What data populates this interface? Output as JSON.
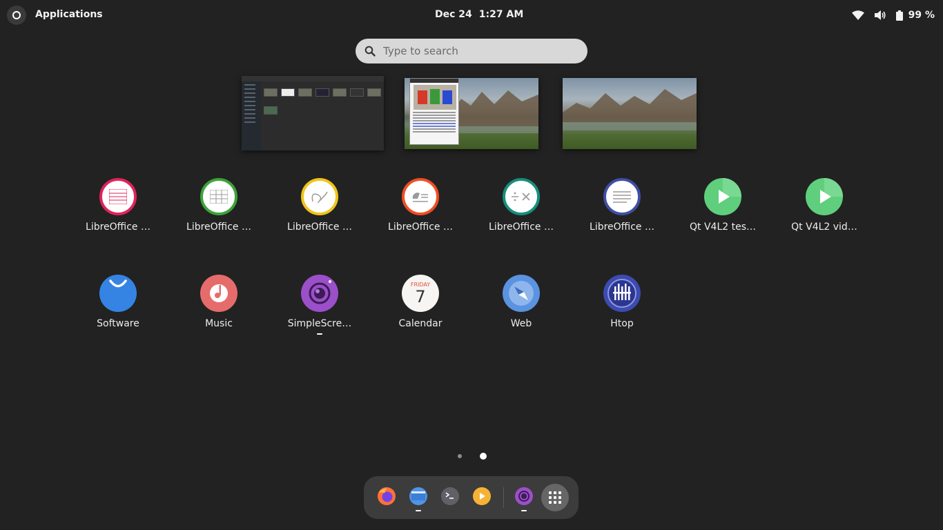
{
  "topbar": {
    "app_name": "Applications",
    "date": "Dec 24",
    "time": "1:27 AM",
    "battery": "99 %",
    "icons": [
      "activities-icon",
      "wifi-icon",
      "volume-icon",
      "battery-icon"
    ]
  },
  "search": {
    "placeholder": "Type to search"
  },
  "workspaces": [
    {
      "name": "workspace-1",
      "content": "file-manager"
    },
    {
      "name": "workspace-2",
      "content": "simplescreenrecorder-window"
    },
    {
      "name": "workspace-3",
      "content": "desktop-wallpaper"
    }
  ],
  "apps_row1": [
    {
      "label": "LibreOffice …",
      "icon": "libreoffice-writer-icon",
      "color": "#e0235b"
    },
    {
      "label": "LibreOffice …",
      "icon": "libreoffice-calc-icon",
      "color": "#3da33a"
    },
    {
      "label": "LibreOffice …",
      "icon": "libreoffice-draw-icon",
      "color": "#f0c419"
    },
    {
      "label": "LibreOffice …",
      "icon": "libreoffice-impress-icon",
      "color": "#f04e23"
    },
    {
      "label": "LibreOffice …",
      "icon": "libreoffice-math-icon",
      "color": "#168f7b"
    },
    {
      "label": "LibreOffice …",
      "icon": "libreoffice-base-icon",
      "color": "#3f4fa3"
    },
    {
      "label": "Qt V4L2 tes…",
      "icon": "qt-v4l2-test-icon",
      "color": "#5fcf7d"
    },
    {
      "label": "Qt V4L2 vid…",
      "icon": "qt-v4l2-video-icon",
      "color": "#5fcf7d"
    }
  ],
  "apps_row2": [
    {
      "label": "Software",
      "icon": "software-icon",
      "color": "#3584e4"
    },
    {
      "label": "Music",
      "icon": "music-icon",
      "color": "#e66c6c"
    },
    {
      "label": "SimpleScre…",
      "icon": "simplescreenrecorder-icon",
      "color": "#9b4fc9",
      "running": true
    },
    {
      "label": "Calendar",
      "icon": "calendar-icon",
      "color": "#ffffff"
    },
    {
      "label": "Web",
      "icon": "web-icon",
      "color": "#5a93e0"
    },
    {
      "label": "Htop",
      "icon": "htop-icon",
      "color": "#3c4bb0"
    }
  ],
  "calendar_icon": {
    "weekday": "FRIDAY",
    "day": "7"
  },
  "pages": {
    "count": 2,
    "current": 2
  },
  "dash": [
    {
      "name": "firefox",
      "icon": "firefox-icon"
    },
    {
      "name": "files",
      "icon": "files-icon",
      "running": true
    },
    {
      "name": "terminal",
      "icon": "terminal-icon"
    },
    {
      "name": "videos",
      "icon": "videos-icon"
    },
    {
      "name": "simplescreenrecorder",
      "icon": "simplescreenrecorder-icon",
      "running": true
    },
    {
      "name": "show-applications",
      "icon": "app-grid-icon"
    }
  ]
}
